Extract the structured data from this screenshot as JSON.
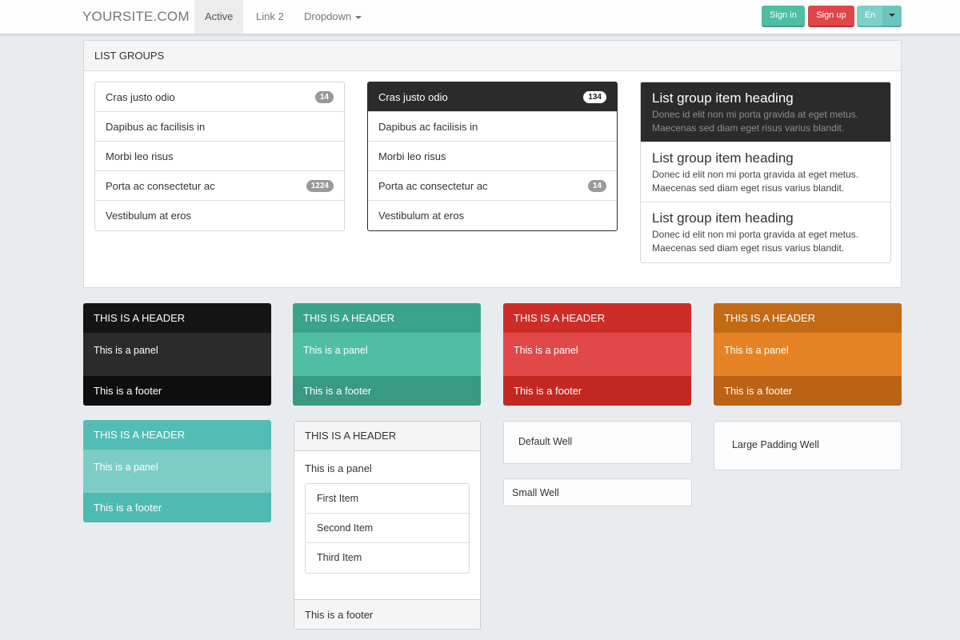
{
  "navbar": {
    "brand": "YOURSITE.COM",
    "links": [
      "Active",
      "Link 2",
      "Dropdown"
    ],
    "signin_label": "Sign in",
    "signup_label": "Sign up",
    "lang_label": "En"
  },
  "list_groups": {
    "title": "LIST GROUPS",
    "group1": [
      {
        "label": "Cras justo odio",
        "badge": "14"
      },
      {
        "label": "Dapibus ac facilisis in",
        "badge": ""
      },
      {
        "label": "Morbi leo risus",
        "badge": ""
      },
      {
        "label": "Porta ac consectetur ac",
        "badge": "1224"
      },
      {
        "label": "Vestibulum at eros",
        "badge": ""
      }
    ],
    "group2": [
      {
        "label": "Cras justo odio",
        "badge": "134"
      },
      {
        "label": "Dapibus ac facilisis in",
        "badge": ""
      },
      {
        "label": "Morbi leo risus",
        "badge": ""
      },
      {
        "label": "Porta ac consectetur ac",
        "badge": "14"
      },
      {
        "label": "Vestibulum at eros",
        "badge": ""
      }
    ],
    "group3": [
      {
        "heading": "List group item heading",
        "text1": "Donec id elit non mi porta gravida at eget metus.",
        "text2": "Maecenas sed diam eget risus varius blandit."
      },
      {
        "heading": "List group item heading",
        "text1": "Donec id elit non mi porta gravida at eget metus.",
        "text2": "Maecenas sed diam eget risus varius blandit."
      },
      {
        "heading": "List group item heading",
        "text1": "Donec id elit non mi porta gravida at eget metus.",
        "text2": "Maecenas sed diam eget risus varius blandit."
      }
    ]
  },
  "panels": {
    "header": "THIS IS A HEADER",
    "body": "This is a panel",
    "footer": "This is a footer",
    "colors": {
      "dark": {
        "head": "#141414",
        "body": "#2b2b2b",
        "foot": "#0e0e0e"
      },
      "green": {
        "head": "#3aa48a",
        "body": "#50bea2",
        "foot": "#389a80"
      },
      "red": {
        "head": "#cd2d29",
        "body": "#e0484a",
        "foot": "#c22822"
      },
      "orange": {
        "head": "#c36a17",
        "body": "#e58324",
        "foot": "#bb6215"
      },
      "teal": {
        "head": "#52bdb5",
        "body": "#7dcdc7",
        "foot": "#4fbab2"
      }
    }
  },
  "list_panel": {
    "header": "THIS IS A HEADER",
    "body": "This is a panel",
    "items": [
      "First Item",
      "Second Item",
      "Third Item"
    ],
    "footer": "This is a footer"
  },
  "wells": {
    "default": "Default Well",
    "small": "Small Well",
    "large": "Large Padding Well"
  }
}
